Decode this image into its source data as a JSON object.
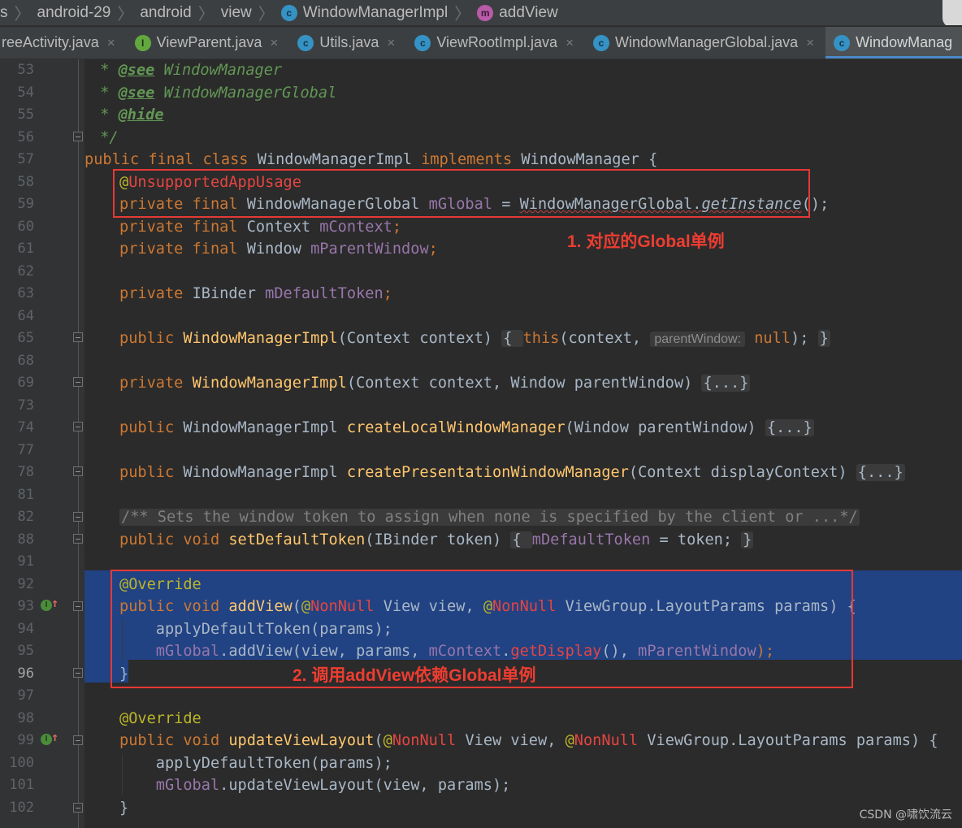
{
  "breadcrumb": {
    "lead": "s",
    "segments": [
      "android-29",
      "android",
      "view"
    ],
    "class_name": "WindowManagerImpl",
    "method_name": "addView",
    "icon_class": "c",
    "icon_method": "m"
  },
  "tabs": [
    {
      "label": "reeActivity.java",
      "icon": null,
      "active": false
    },
    {
      "label": "ViewParent.java",
      "icon": "I",
      "icon_kind": "interface",
      "active": false
    },
    {
      "label": "Utils.java",
      "icon": "c",
      "icon_kind": "class",
      "active": false
    },
    {
      "label": "ViewRootImpl.java",
      "icon": "c",
      "icon_kind": "class",
      "active": false
    },
    {
      "label": "WindowManagerGlobal.java",
      "icon": "c",
      "icon_kind": "class",
      "active": false
    },
    {
      "label": "WindowManag",
      "icon": "c",
      "icon_kind": "class",
      "active": true
    }
  ],
  "close_glyph": "×",
  "line_numbers": [
    "53",
    "54",
    "55",
    "56",
    "57",
    "58",
    "59",
    "60",
    "61",
    "62",
    "63",
    "64",
    "65",
    "68",
    "69",
    "73",
    "74",
    "77",
    "78",
    "81",
    "82",
    "88",
    "91",
    "92",
    "93",
    "94",
    "95",
    "96",
    "97",
    "98",
    "99",
    "100",
    "101",
    "102"
  ],
  "current_line": "96",
  "code": {
    "l53": {
      "star": " * ",
      "tag": "@see",
      "rest": " WindowManager"
    },
    "l54": {
      "star": " * ",
      "tag": "@see",
      "rest": " WindowManagerGlobal"
    },
    "l55": {
      "star": " * ",
      "tag": "@hide"
    },
    "l56": {
      "text": " */"
    },
    "l57": {
      "kw": "public final class ",
      "name": "WindowManagerImpl ",
      "kw2": "implements ",
      "rest": "WindowManager {"
    },
    "l58": {
      "at": "@",
      "anno": "UnsupportedAppUsage"
    },
    "l59": {
      "kw": "private final ",
      "type": "WindowManagerGlobal ",
      "field": "mGlobal",
      "eq": " = ",
      "cls": "WindowManagerGlobal.",
      "call": "getInstance",
      "end": "();"
    },
    "l60": {
      "kw": "private final ",
      "type": "Context ",
      "field": "mContext",
      "end": ";"
    },
    "l61": {
      "kw": "private final ",
      "type": "Window ",
      "field": "mParentWindow",
      "end": ";"
    },
    "l63": {
      "kw": "private ",
      "type": "IBinder ",
      "field": "mDefaultToken",
      "end": ";"
    },
    "l65": {
      "kw": "public ",
      "fn": "WindowManagerImpl",
      "args": "(Context context) ",
      "brace1": "{ ",
      "kw2": "this",
      "call": "(context, ",
      "hint": "parentWindow:",
      "kw3": " null",
      "end": "); ",
      "brace2": "}"
    },
    "l69": {
      "kw": "private ",
      "fn": "WindowManagerImpl",
      "args": "(Context context, Window parentWindow) ",
      "pill": "{...}"
    },
    "l74": {
      "kw": "public ",
      "type": "WindowManagerImpl ",
      "fn": "createLocalWindowManager",
      "args": "(Window parentWindow) ",
      "pill": "{...}"
    },
    "l78": {
      "kw": "public ",
      "type": "WindowManagerImpl ",
      "fn": "createPresentationWindowManager",
      "args": "(Context displayContext) ",
      "pill": "{...}"
    },
    "l82": {
      "text": "/** Sets the window token to assign when none is specified by the client or ...*/"
    },
    "l88": {
      "kw": "public void ",
      "fn": "setDefaultToken",
      "args": "(IBinder token) ",
      "brace1": "{ ",
      "field": "mDefaultToken",
      "rest": " = token; ",
      "brace2": "}"
    },
    "l92": {
      "anno": "@Override"
    },
    "l93": {
      "kw": "public void ",
      "fn": "addView",
      "p1": "(",
      "at1": "@",
      "nn1": "NonNull",
      "t1": " View view, ",
      "at2": "@",
      "nn2": "NonNull",
      "t2": " ViewGroup.LayoutParams params) {"
    },
    "l94": {
      "text": "    applyDefaultToken(params);"
    },
    "l95": {
      "indent": "    ",
      "field1": "mGlobal",
      "m": ".addView(view, params, ",
      "field2": "mContext",
      "dot": ".",
      "field3": "getDisplay",
      "mid": "(), ",
      "field4": "mParentWindow",
      "end": ");"
    },
    "l96": {
      "text": "}"
    },
    "l98": {
      "anno": "@Override"
    },
    "l99": {
      "kw": "public void ",
      "fn": "updateViewLayout",
      "p1": "(",
      "at1": "@",
      "nn1": "NonNull",
      "t1": " View view, ",
      "at2": "@",
      "nn2": "NonNull",
      "t2": " ViewGroup.LayoutParams params) {"
    },
    "l100": {
      "text": "    applyDefaultToken(params);"
    },
    "l101": {
      "indent": "    ",
      "field": "mGlobal",
      "rest": ".updateViewLayout(view, params);"
    },
    "l102": {
      "text": "}"
    }
  },
  "annotations": {
    "label1": "1. 对应的Global单例",
    "label2": "2. 调用addView依赖Global单例"
  },
  "watermark": "CSDN @啸饮流云",
  "colors": {
    "keyword": "#cc7832",
    "function": "#ffc66d",
    "field": "#9876aa",
    "doc": "#629755",
    "annotation": "#bbb529",
    "selection": "#214283",
    "highlight_box": "#e53935"
  }
}
